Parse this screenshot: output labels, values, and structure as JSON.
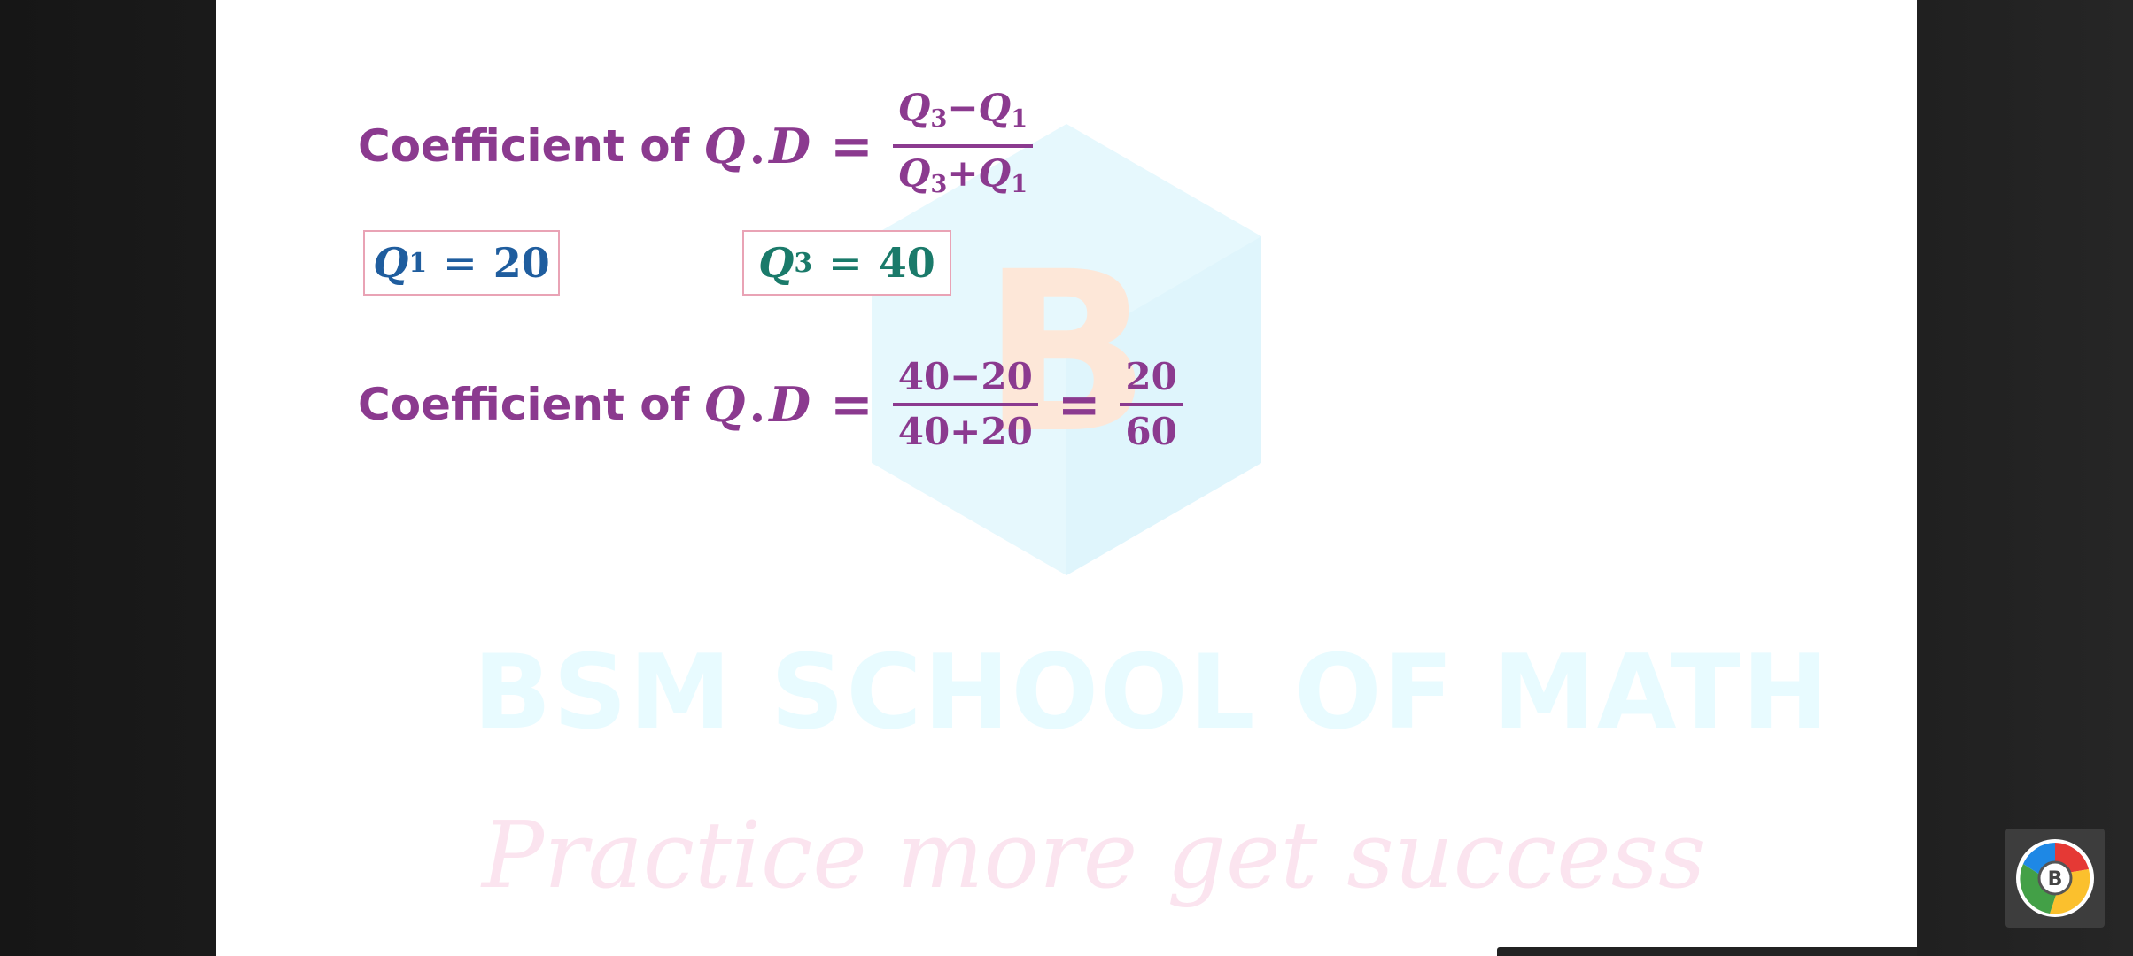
{
  "watermark": {
    "logo_letter": "B",
    "title": "BSM SCHOOL OF MATH",
    "tagline": "Practice more get success"
  },
  "equation_1": {
    "label": "Coefficient of",
    "var_q": "Q",
    "dot": ".",
    "var_d": "D",
    "equals": "=",
    "numerator": {
      "a": "Q",
      "a_sub": "3",
      "op": "−",
      "b": "Q",
      "b_sub": "1"
    },
    "denominator": {
      "a": "Q",
      "a_sub": "3",
      "op": "+",
      "b": "Q",
      "b_sub": "1"
    }
  },
  "given": {
    "q1": {
      "var": "Q",
      "sub": "1",
      "equals": "=",
      "value": "20"
    },
    "q3": {
      "var": "Q",
      "sub": "3",
      "equals": "=",
      "value": "40"
    }
  },
  "equation_2": {
    "label": "Coefficient of",
    "var_q": "Q",
    "dot": ".",
    "var_d": "D",
    "equals": "=",
    "frac1": {
      "numerator": "40−20",
      "denominator": "40+20"
    },
    "equals_2": "=",
    "frac2": {
      "numerator": "20",
      "denominator": "60"
    }
  },
  "overlay": {
    "app_icon": "chrome-bubble-icon",
    "app_icon_letter": "B"
  },
  "colors": {
    "formula": "#8b3a8f",
    "q1_value": "#1f5d9e",
    "q3_value": "#1a7a6a",
    "box_border": "#e9a3b5",
    "watermark_blue": "#e8fbff",
    "watermark_pink": "#fbe4ef"
  }
}
